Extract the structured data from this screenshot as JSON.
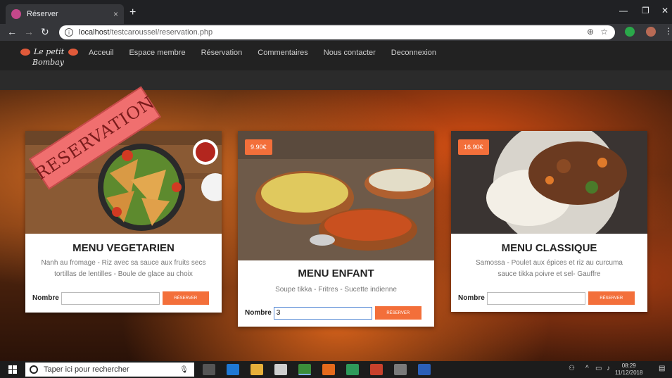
{
  "browser": {
    "tab_title": "Réserver",
    "tab_close": "×",
    "new_tab": "+",
    "url_host": "localhost",
    "url_path": "/testcaroussel/reservation.php"
  },
  "nav": {
    "logo_line1": "Le petit",
    "logo_line2": "Bombay",
    "links": [
      "Acceuil",
      "Espace membre",
      "Réservation",
      "Commentaires",
      "Nous contacter",
      "Deconnexion"
    ]
  },
  "ribbon": "RESERVATION",
  "cards": [
    {
      "price": "",
      "title": "MENU VEGETARIEN",
      "desc_line1": "Nanh au fromage - Riz avec sa sauce aux fruits secs",
      "desc_line2": "tortillas de lentilles - Boule de glace au choix",
      "label": "Nombre",
      "value": "",
      "button": "RÉSERVER"
    },
    {
      "price": "9.90€",
      "title": "MENU ENFANT",
      "desc_line1": "Soupe tikka - Fritres - Sucette indienne",
      "desc_line2": "",
      "label": "Nombre",
      "value": "3",
      "button": "RÉSERVER"
    },
    {
      "price": "16.90€",
      "title": "MENU CLASSIQUE",
      "desc_line1": "Samossa - Poulet aux épices et riz au curcuma",
      "desc_line2": "sauce tikka poivre et sel- Gauffre",
      "label": "Nombre",
      "value": "",
      "button": "RÉSERVER"
    }
  ],
  "taskbar": {
    "search_placeholder": "Taper ici pour rechercher",
    "time": "08:29",
    "date": "11/12/2018"
  }
}
